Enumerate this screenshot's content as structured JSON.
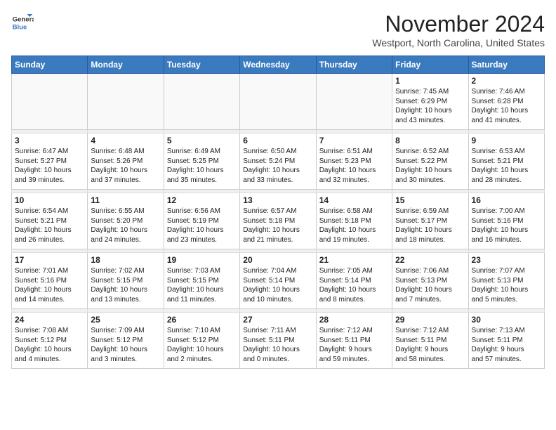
{
  "header": {
    "logo_line1": "General",
    "logo_line2": "Blue",
    "month": "November 2024",
    "location": "Westport, North Carolina, United States"
  },
  "days_of_week": [
    "Sunday",
    "Monday",
    "Tuesday",
    "Wednesday",
    "Thursday",
    "Friday",
    "Saturday"
  ],
  "weeks": [
    {
      "cells": [
        {
          "empty": true
        },
        {
          "empty": true
        },
        {
          "empty": true
        },
        {
          "empty": true
        },
        {
          "empty": true
        },
        {
          "day": "1",
          "text": "Sunrise: 7:45 AM\nSunset: 6:29 PM\nDaylight: 10 hours\nand 43 minutes."
        },
        {
          "day": "2",
          "text": "Sunrise: 7:46 AM\nSunset: 6:28 PM\nDaylight: 10 hours\nand 41 minutes."
        }
      ]
    },
    {
      "cells": [
        {
          "day": "3",
          "text": "Sunrise: 6:47 AM\nSunset: 5:27 PM\nDaylight: 10 hours\nand 39 minutes."
        },
        {
          "day": "4",
          "text": "Sunrise: 6:48 AM\nSunset: 5:26 PM\nDaylight: 10 hours\nand 37 minutes."
        },
        {
          "day": "5",
          "text": "Sunrise: 6:49 AM\nSunset: 5:25 PM\nDaylight: 10 hours\nand 35 minutes."
        },
        {
          "day": "6",
          "text": "Sunrise: 6:50 AM\nSunset: 5:24 PM\nDaylight: 10 hours\nand 33 minutes."
        },
        {
          "day": "7",
          "text": "Sunrise: 6:51 AM\nSunset: 5:23 PM\nDaylight: 10 hours\nand 32 minutes."
        },
        {
          "day": "8",
          "text": "Sunrise: 6:52 AM\nSunset: 5:22 PM\nDaylight: 10 hours\nand 30 minutes."
        },
        {
          "day": "9",
          "text": "Sunrise: 6:53 AM\nSunset: 5:21 PM\nDaylight: 10 hours\nand 28 minutes."
        }
      ]
    },
    {
      "cells": [
        {
          "day": "10",
          "text": "Sunrise: 6:54 AM\nSunset: 5:21 PM\nDaylight: 10 hours\nand 26 minutes."
        },
        {
          "day": "11",
          "text": "Sunrise: 6:55 AM\nSunset: 5:20 PM\nDaylight: 10 hours\nand 24 minutes."
        },
        {
          "day": "12",
          "text": "Sunrise: 6:56 AM\nSunset: 5:19 PM\nDaylight: 10 hours\nand 23 minutes."
        },
        {
          "day": "13",
          "text": "Sunrise: 6:57 AM\nSunset: 5:18 PM\nDaylight: 10 hours\nand 21 minutes."
        },
        {
          "day": "14",
          "text": "Sunrise: 6:58 AM\nSunset: 5:18 PM\nDaylight: 10 hours\nand 19 minutes."
        },
        {
          "day": "15",
          "text": "Sunrise: 6:59 AM\nSunset: 5:17 PM\nDaylight: 10 hours\nand 18 minutes."
        },
        {
          "day": "16",
          "text": "Sunrise: 7:00 AM\nSunset: 5:16 PM\nDaylight: 10 hours\nand 16 minutes."
        }
      ]
    },
    {
      "cells": [
        {
          "day": "17",
          "text": "Sunrise: 7:01 AM\nSunset: 5:16 PM\nDaylight: 10 hours\nand 14 minutes."
        },
        {
          "day": "18",
          "text": "Sunrise: 7:02 AM\nSunset: 5:15 PM\nDaylight: 10 hours\nand 13 minutes."
        },
        {
          "day": "19",
          "text": "Sunrise: 7:03 AM\nSunset: 5:15 PM\nDaylight: 10 hours\nand 11 minutes."
        },
        {
          "day": "20",
          "text": "Sunrise: 7:04 AM\nSunset: 5:14 PM\nDaylight: 10 hours\nand 10 minutes."
        },
        {
          "day": "21",
          "text": "Sunrise: 7:05 AM\nSunset: 5:14 PM\nDaylight: 10 hours\nand 8 minutes."
        },
        {
          "day": "22",
          "text": "Sunrise: 7:06 AM\nSunset: 5:13 PM\nDaylight: 10 hours\nand 7 minutes."
        },
        {
          "day": "23",
          "text": "Sunrise: 7:07 AM\nSunset: 5:13 PM\nDaylight: 10 hours\nand 5 minutes."
        }
      ]
    },
    {
      "cells": [
        {
          "day": "24",
          "text": "Sunrise: 7:08 AM\nSunset: 5:12 PM\nDaylight: 10 hours\nand 4 minutes."
        },
        {
          "day": "25",
          "text": "Sunrise: 7:09 AM\nSunset: 5:12 PM\nDaylight: 10 hours\nand 3 minutes."
        },
        {
          "day": "26",
          "text": "Sunrise: 7:10 AM\nSunset: 5:12 PM\nDaylight: 10 hours\nand 2 minutes."
        },
        {
          "day": "27",
          "text": "Sunrise: 7:11 AM\nSunset: 5:11 PM\nDaylight: 10 hours\nand 0 minutes."
        },
        {
          "day": "28",
          "text": "Sunrise: 7:12 AM\nSunset: 5:11 PM\nDaylight: 9 hours\nand 59 minutes."
        },
        {
          "day": "29",
          "text": "Sunrise: 7:12 AM\nSunset: 5:11 PM\nDaylight: 9 hours\nand 58 minutes."
        },
        {
          "day": "30",
          "text": "Sunrise: 7:13 AM\nSunset: 5:11 PM\nDaylight: 9 hours\nand 57 minutes."
        }
      ]
    }
  ]
}
